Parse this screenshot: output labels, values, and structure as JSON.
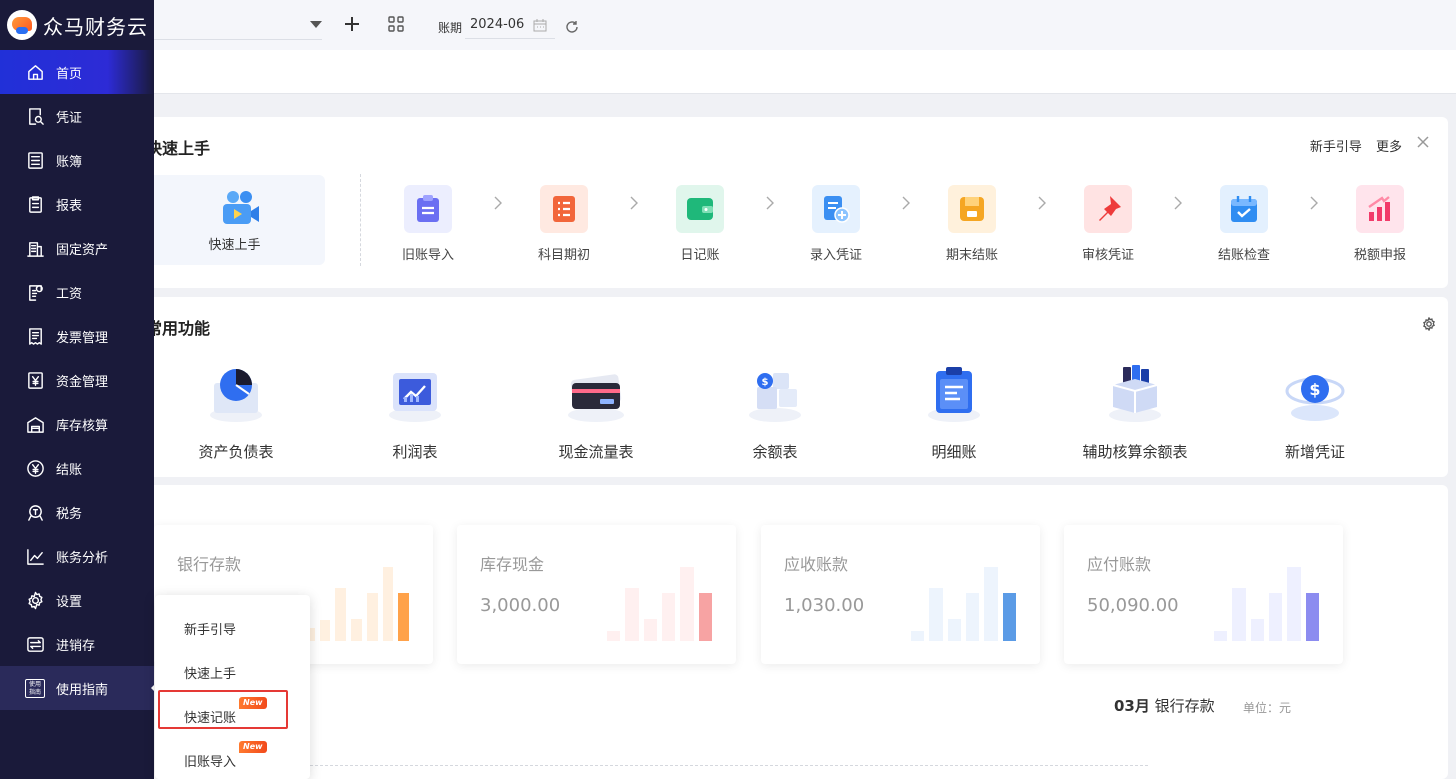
{
  "app": {
    "name": "众马财务云"
  },
  "sidebar": {
    "items": [
      {
        "label": "首页",
        "icon": "home-icon"
      },
      {
        "label": "凭证",
        "icon": "voucher-search-icon"
      },
      {
        "label": "账簿",
        "icon": "ledger-icon"
      },
      {
        "label": "报表",
        "icon": "report-icon"
      },
      {
        "label": "固定资产",
        "icon": "building-icon"
      },
      {
        "label": "工资",
        "icon": "salary-icon"
      },
      {
        "label": "发票管理",
        "icon": "invoice-icon"
      },
      {
        "label": "资金管理",
        "icon": "yen-box-icon"
      },
      {
        "label": "库存核算",
        "icon": "warehouse-icon"
      },
      {
        "label": "结账",
        "icon": "yen-circle-icon"
      },
      {
        "label": "税务",
        "icon": "tax-icon"
      },
      {
        "label": "账务分析",
        "icon": "trend-icon"
      },
      {
        "label": "设置",
        "icon": "gear-icon"
      },
      {
        "label": "进销存",
        "icon": "exchange-icon"
      },
      {
        "label": "使用指南",
        "icon": "guide-icon",
        "icon_text_1": "使用",
        "icon_text_2": "指南"
      }
    ]
  },
  "topbar": {
    "company_value": "",
    "period_label": "账期",
    "period_value": "2024-06"
  },
  "quick_start": {
    "title": "快速上手",
    "link_guide": "新手引导",
    "link_more": "更多",
    "hero_label": "快速上手",
    "steps": [
      {
        "label": "旧账导入",
        "icon": "clipboard-icon",
        "color": "#6b6ff2"
      },
      {
        "label": "科目期初",
        "icon": "list-icon",
        "color": "#f2663b"
      },
      {
        "label": "日记账",
        "icon": "wallet-icon",
        "color": "#1fb87a"
      },
      {
        "label": "录入凭证",
        "icon": "add-document-icon",
        "color": "#3b8ff2"
      },
      {
        "label": "期末结账",
        "icon": "save-box-icon",
        "color": "#f5a623"
      },
      {
        "label": "审核凭证",
        "icon": "pin-icon",
        "color": "#ee3b3b"
      },
      {
        "label": "结账检查",
        "icon": "calendar-check-icon",
        "color": "#2f8df2"
      },
      {
        "label": "税额申报",
        "icon": "bar-chart-up-icon",
        "color": "#f23b6a"
      }
    ]
  },
  "common_functions": {
    "title": "常用功能",
    "items": [
      {
        "label": "资产负债表",
        "icon": "pie-chart-icon"
      },
      {
        "label": "利润表",
        "icon": "line-chart-icon"
      },
      {
        "label": "现金流量表",
        "icon": "cards-icon"
      },
      {
        "label": "余额表",
        "icon": "coin-cubes-icon"
      },
      {
        "label": "明细账",
        "icon": "clipboard-detail-icon"
      },
      {
        "label": "辅助核算余额表",
        "icon": "box-files-icon"
      },
      {
        "label": "新增凭证",
        "icon": "dollar-coin-icon"
      }
    ]
  },
  "stats": [
    {
      "title": "银行存款",
      "value": "",
      "bar_color": "#ffa24a",
      "bar_light": "#fff0e0",
      "bars": [
        0.18,
        0.28,
        0.72,
        0.3,
        0.65,
        1.0,
        0.65
      ]
    },
    {
      "title": "库存现金",
      "value": "3,000.00",
      "bar_color": "#f7a3a3",
      "bar_light": "#fff0f0",
      "bars": [
        0.14,
        0.72,
        0.3,
        0.65,
        1.0,
        0.65
      ]
    },
    {
      "title": "应收账款",
      "value": "1,030.00",
      "bar_color": "#5b9be6",
      "bar_light": "#edf4fd",
      "bars": [
        0.14,
        0.72,
        0.3,
        0.65,
        1.0,
        0.65
      ]
    },
    {
      "title": "应付账款",
      "value": "50,090.00",
      "bar_color": "#8c8cf0",
      "bar_light": "#eef0ff",
      "bars": [
        0.14,
        0.72,
        0.3,
        0.65,
        1.0,
        0.65
      ]
    }
  ],
  "chart_header": {
    "month": "03月",
    "name": "银行存款",
    "unit": "单位：元"
  },
  "guide_popup": {
    "items": [
      {
        "label": "新手引导",
        "badge": ""
      },
      {
        "label": "快速上手",
        "badge": ""
      },
      {
        "label": "快速记账",
        "badge": "New"
      },
      {
        "label": "旧账导入",
        "badge": "New"
      }
    ]
  }
}
